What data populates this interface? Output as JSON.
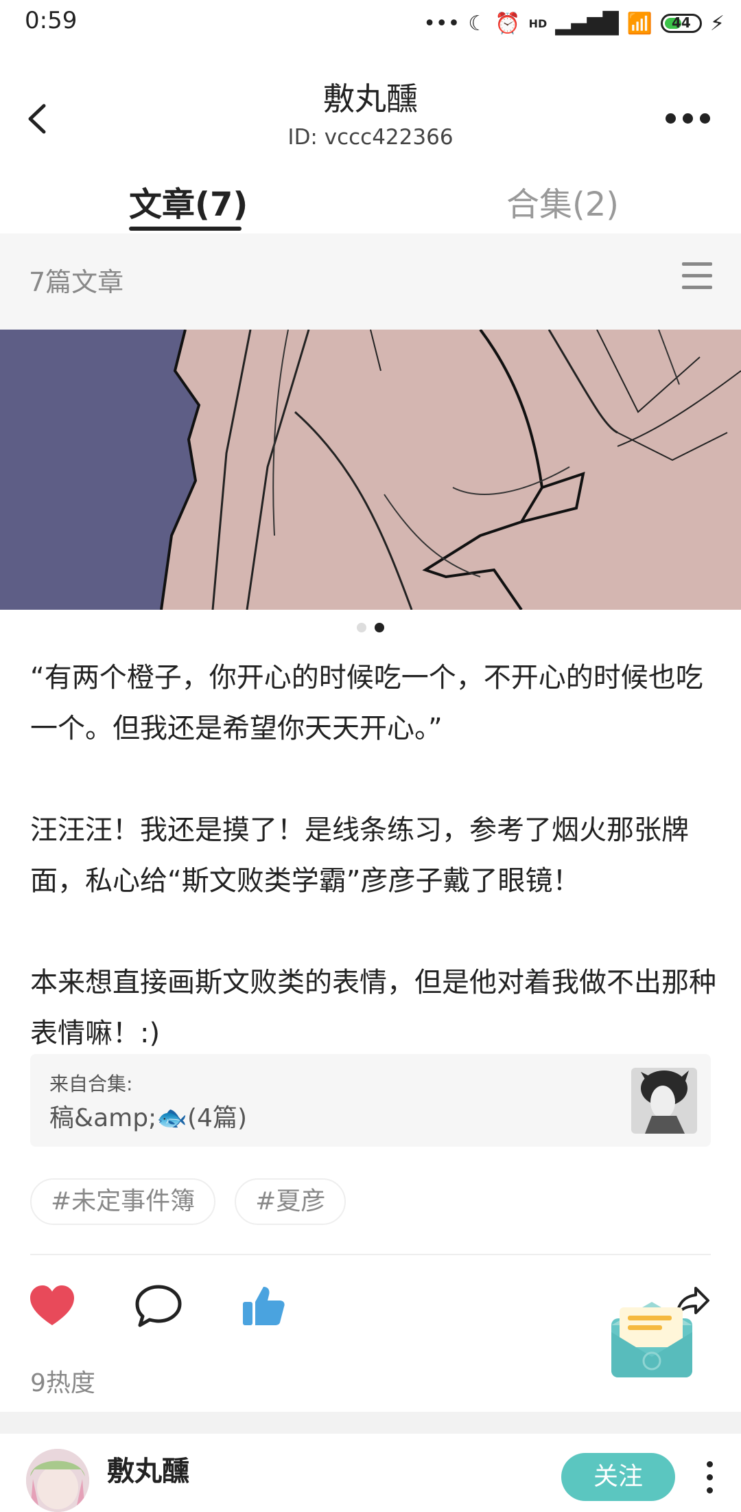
{
  "status": {
    "time": "0:59",
    "battery": "44",
    "network": "HD"
  },
  "header": {
    "title": "敷丸醺",
    "user_id": "ID: vccc422366"
  },
  "tabs": [
    {
      "label": "文章(7)"
    },
    {
      "label": "合集(2)"
    }
  ],
  "count_bar": {
    "text": "7篇文章"
  },
  "carousel": {
    "total": 2,
    "active_index": 1
  },
  "post": {
    "paragraphs": [
      "“有两个橙子，你开心的时候吃一个，不开心的时候也吃一个。但我还是希望你天天开心。”",
      "汪汪汪！我还是摸了！是线条练习，参考了烟火那张牌面，私心给“斯文败类学霸”彦彦子戴了眼镜！",
      "本来想直接画斯文败类的表情，但是他对着我做不出那种表情嘛！:)"
    ],
    "collection_label": "来自合集:",
    "collection_name": "稿&amp;🐟(4篇)",
    "tags": [
      "#未定事件簿",
      "#夏彦"
    ],
    "heat": "9热度"
  },
  "author": {
    "name": "敷丸醺",
    "follow_label": "关注"
  },
  "colors": {
    "accent": "#5bc6c0",
    "like": "#e84a5a",
    "thumb": "#4aa3df"
  }
}
